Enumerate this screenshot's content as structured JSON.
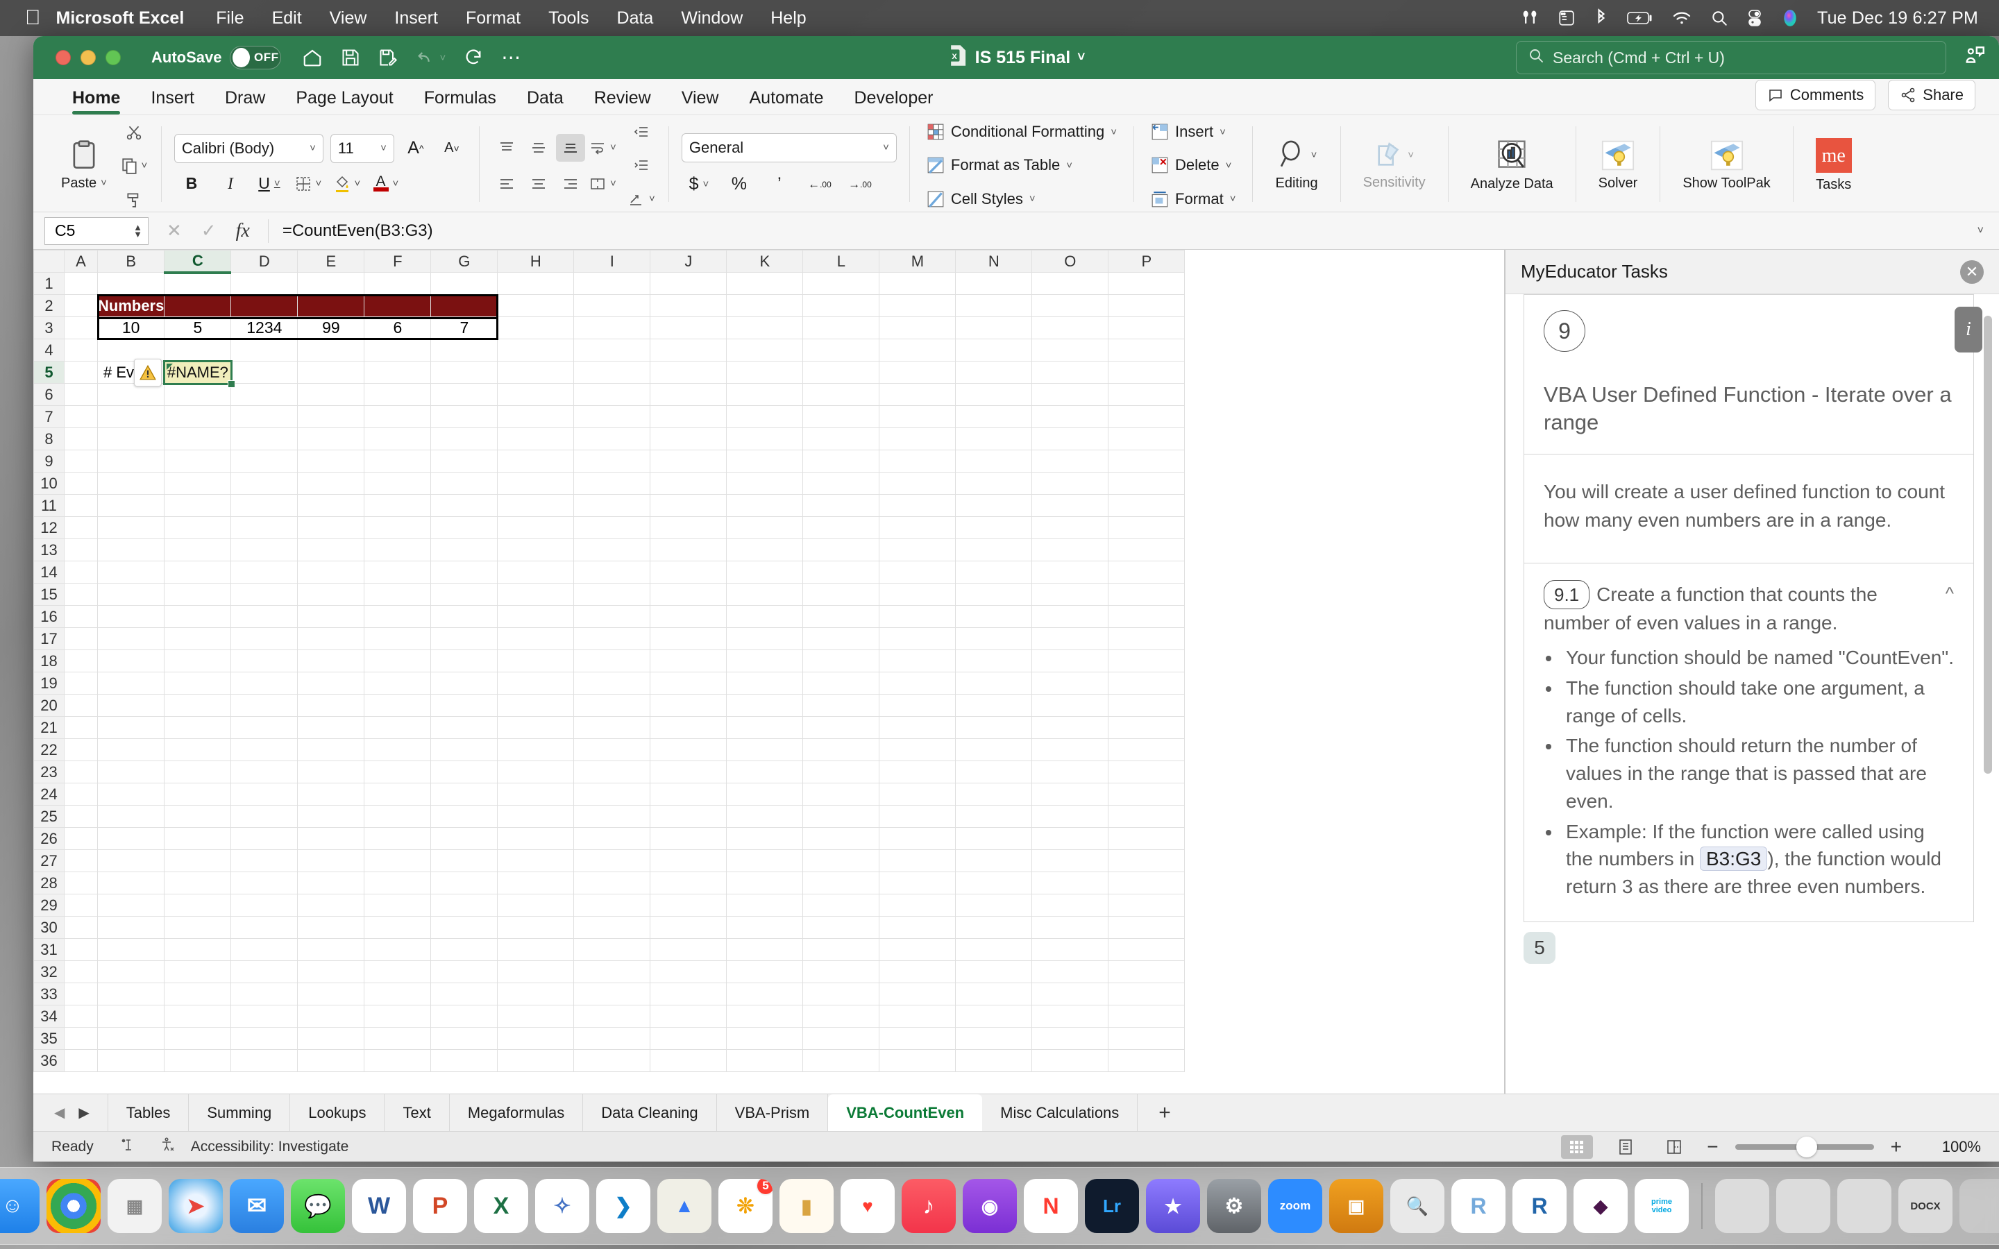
{
  "menubar": {
    "apple": "apple-logo",
    "app": "Microsoft Excel",
    "items": [
      "File",
      "Edit",
      "View",
      "Insert",
      "Format",
      "Tools",
      "Data",
      "Window",
      "Help"
    ],
    "clock": "Tue Dec 19  6:27 PM",
    "status_icons": [
      "airpods-icon",
      "shortcuts-icon",
      "bluetooth-icon",
      "battery-charging-icon",
      "wifi-icon",
      "spotlight-search-icon",
      "control-center-icon",
      "siri-icon"
    ]
  },
  "titlebar": {
    "autosave_label": "AutoSave",
    "autosave_state": "OFF",
    "document_title": "IS 515 Final",
    "quick_access": [
      "home-icon",
      "save-icon",
      "save-as-icon",
      "undo-icon",
      "redo-icon",
      "more-icon"
    ],
    "search_placeholder": "Search (Cmd + Ctrl + U)",
    "collab_icon": "collaborate-icon",
    "accent_color": "#2f7d4f"
  },
  "ribbon": {
    "tabs": [
      "Home",
      "Insert",
      "Draw",
      "Page Layout",
      "Formulas",
      "Data",
      "Review",
      "View",
      "Automate",
      "Developer"
    ],
    "active_tab": "Home",
    "comments_label": "Comments",
    "share_label": "Share",
    "clipboard": {
      "paste_label": "Paste",
      "cut_icon": "scissors-icon",
      "copy_icon": "copy-icon",
      "format_painter_icon": "paintbrush-icon"
    },
    "font": {
      "family": "Calibri (Body)",
      "size": "11",
      "grow_icon": "increase-font-size-icon",
      "shrink_icon": "decrease-font-size-icon",
      "bold": "B",
      "italic": "I",
      "underline": "U",
      "borders_icon": "borders-icon",
      "fill_icon": "fill-color-icon",
      "font_color_icon": "font-color-icon"
    },
    "alignment": {
      "align_top_icon": "align-top-icon",
      "align_middle_icon": "align-middle-icon",
      "align_bottom_icon": "align-bottom-icon",
      "wrap_text_icon": "wrap-text-icon",
      "align_left_icon": "align-left-icon",
      "align_center_icon": "align-center-icon",
      "align_right_icon": "align-right-icon",
      "merge_icon": "merge-cells-icon",
      "decrease_indent_icon": "decrease-indent-icon",
      "increase_indent_icon": "increase-indent-icon",
      "orientation_icon": "text-orientation-icon"
    },
    "number": {
      "format": "General",
      "currency_icon": "currency-icon",
      "percent_icon": "percent-icon",
      "comma_icon": "comma-style-icon",
      "increase_decimal_icon": "increase-decimal-icon",
      "decrease_decimal_icon": "decrease-decimal-icon"
    },
    "styles": [
      {
        "label": "Conditional Formatting",
        "icon": "conditional-formatting-icon"
      },
      {
        "label": "Format as Table",
        "icon": "format-as-table-icon"
      },
      {
        "label": "Cell Styles",
        "icon": "cell-styles-icon"
      }
    ],
    "cells": [
      {
        "label": "Insert",
        "icon": "insert-cells-icon"
      },
      {
        "label": "Delete",
        "icon": "delete-cells-icon"
      },
      {
        "label": "Format",
        "icon": "format-cells-icon"
      }
    ],
    "editing_label": "Editing",
    "right_buttons": [
      {
        "label": "Sensitivity",
        "icon": "sensitivity-icon",
        "dim": true
      },
      {
        "label": "Analyze Data",
        "icon": "analyze-data-icon",
        "dim": false
      },
      {
        "label": "Solver",
        "icon": "solver-icon",
        "dim": false
      },
      {
        "label": "Show ToolPak",
        "icon": "show-toolpak-icon",
        "dim": false
      },
      {
        "label": "Tasks",
        "icon": "me-tasks-icon",
        "dim": false
      }
    ]
  },
  "formula_bar": {
    "name_box": "C5",
    "cancel_icon": "cancel-icon",
    "enter_icon": "confirm-icon",
    "fx_icon": "insert-function-icon",
    "formula": "=CountEven(B3:G3)",
    "expand_icon": "expand-formula-bar-icon"
  },
  "grid": {
    "columns": [
      "A",
      "B",
      "C",
      "D",
      "E",
      "F",
      "G",
      "H",
      "I",
      "J",
      "K",
      "L",
      "M",
      "N",
      "O",
      "P"
    ],
    "selected_column": "C",
    "rows": [
      1,
      2,
      3,
      4,
      5,
      6,
      7,
      8,
      9,
      10,
      11,
      12,
      13,
      14,
      15,
      16,
      17,
      18,
      19,
      20,
      21,
      22,
      23,
      24,
      25,
      26,
      27,
      28,
      29,
      30,
      31,
      32,
      33,
      34,
      35,
      36
    ],
    "selected_row": 5,
    "table_header": {
      "cell": "B2",
      "text": "Numbers",
      "bg": "#7b1111",
      "fg": "#ffffff"
    },
    "numbers_row": {
      "row": 3,
      "cells": [
        "10",
        "5",
        "1234",
        "99",
        "6",
        "7"
      ]
    },
    "label_cell": {
      "cell": "B5",
      "text": "# Even"
    },
    "active_cell": {
      "cell": "C5",
      "display": "#NAME?",
      "bg": "#f1eebc"
    },
    "warning_icon": "warning-triangle-icon"
  },
  "task_pane": {
    "title": "MyEducator Tasks",
    "close_icon": "close-icon",
    "info_icon": "info-icon",
    "task_number": "9",
    "task_title": "VBA User Defined Function - Iterate over a range",
    "task_description": "You will create a user defined function to count how many even numbers are in a range.",
    "subtask": {
      "number": "9.1",
      "heading": "Create a function that counts the number of even values in a range.",
      "collapse_icon": "chevron-up-icon",
      "bullets": [
        "Your function should be named \"CountEven\".",
        "The function should take one argument, a range of cells.",
        "The function should return the number of values in the range that is passed that are even.",
        "Example: If the function were called using the numbers in B3:G3), the function would return 3 as there are three even numbers."
      ],
      "bullet4_prefix": "Example: If the function were called using the numbers in ",
      "bullet4_code": "B3:G3",
      "bullet4_suffix": "), the function would return 3 as there are three even numbers."
    },
    "next_task_number": "5"
  },
  "sheet_tabs": {
    "prev_icon": "previous-sheet-icon",
    "next_icon": "next-sheet-icon",
    "tabs": [
      "Tables",
      "Summing",
      "Lookups",
      "Text",
      "Megaformulas",
      "Data Cleaning",
      "VBA-Prism",
      "VBA-CountEven",
      "Misc Calculations"
    ],
    "active": "VBA-CountEven",
    "add_label": "+"
  },
  "status_bar": {
    "state": "Ready",
    "state_icon": "cell-mode-icon",
    "accessibility_icon": "accessibility-icon",
    "accessibility_label": "Accessibility: Investigate",
    "views": [
      "normal-view-icon",
      "page-layout-view-icon",
      "page-break-view-icon"
    ],
    "active_view": "normal-view-icon",
    "zoom_out_label": "−",
    "zoom_in_label": "+",
    "zoom_level": "100%"
  },
  "dock": {
    "icons": [
      {
        "name": "finder-icon",
        "glyph": "",
        "bg": "linear-gradient(180deg,#4aa8ff,#1e80e8)",
        "running": true
      },
      {
        "name": "google-chrome-icon",
        "glyph": "",
        "bg": "radial-gradient(circle at 50% 50%, #fff 0 16%, #4285f4 16% 34%, #34a853 34% 60%, #fbbc05 60% 78%, #ea4335 78% 100%)",
        "running": true
      },
      {
        "name": "launchpad-icon",
        "glyph": "",
        "bg": "#f2f2f2",
        "running": false
      },
      {
        "name": "safari-icon",
        "glyph": "",
        "bg": "radial-gradient(circle,#eaf4ff 30%,#2f9be3 100%)",
        "running": false
      },
      {
        "name": "mail-icon",
        "glyph": "✉",
        "bg": "linear-gradient(180deg,#4aa8ff,#2a7fe0)",
        "running": false
      },
      {
        "name": "messages-icon",
        "glyph": "",
        "bg": "linear-gradient(180deg,#6ce36c,#35c23a)",
        "running": false
      },
      {
        "name": "microsoft-word-icon",
        "glyph": "W",
        "bg": "#ffffff",
        "running": false
      },
      {
        "name": "microsoft-powerpoint-icon",
        "glyph": "P",
        "bg": "#ffffff",
        "running": false
      },
      {
        "name": "microsoft-excel-icon",
        "glyph": "X",
        "bg": "#ffffff",
        "running": true
      },
      {
        "name": "sparkles-app-icon",
        "glyph": "",
        "bg": "#ffffff",
        "running": false
      },
      {
        "name": "visual-studio-code-icon",
        "glyph": "",
        "bg": "#ffffff",
        "running": false
      },
      {
        "name": "maps-icon",
        "glyph": "",
        "bg": "#f0efe6",
        "running": false
      },
      {
        "name": "photos-icon",
        "glyph": "",
        "bg": "#ffffff",
        "running": false,
        "badge": "5"
      },
      {
        "name": "notes-icon",
        "glyph": "",
        "bg": "#fffaf0",
        "running": false
      },
      {
        "name": "health-icon",
        "glyph": "",
        "bg": "#ffffff",
        "running": false
      },
      {
        "name": "music-icon",
        "glyph": "♪",
        "bg": "linear-gradient(180deg,#fc5c65,#f3344a)",
        "running": false
      },
      {
        "name": "podcasts-icon",
        "glyph": "",
        "bg": "linear-gradient(180deg,#a457e8,#7b2fd4)",
        "running": false
      },
      {
        "name": "news-icon",
        "glyph": "N",
        "bg": "#ffffff",
        "running": false
      },
      {
        "name": "lightroom-icon",
        "glyph": "Lr",
        "bg": "#0f1b2d",
        "running": false
      },
      {
        "name": "awards-app-icon",
        "glyph": "★",
        "bg": "linear-gradient(180deg,#8e7bff,#5b4bd6)",
        "running": false
      },
      {
        "name": "settings-icon",
        "glyph": "",
        "bg": "linear-gradient(180deg,#9aa0a6,#5f6368)",
        "running": false
      },
      {
        "name": "zoom-icon",
        "glyph": "zoom",
        "bg": "#2d8cff",
        "running": false
      },
      {
        "name": "keynote-icon",
        "glyph": "",
        "bg": "linear-gradient(180deg,#f0a020,#d07a10)",
        "running": false
      },
      {
        "name": "preview-icon",
        "glyph": "",
        "bg": "#e9e9e9",
        "running": false
      },
      {
        "name": "r-studio-icon",
        "glyph": "R",
        "bg": "#ffffff",
        "running": false
      },
      {
        "name": "r-icon",
        "glyph": "R",
        "bg": "#ffffff",
        "running": false
      },
      {
        "name": "slack-icon",
        "glyph": "",
        "bg": "#ffffff",
        "running": false
      },
      {
        "name": "amazon-prime-video-icon",
        "glyph": "prime video",
        "bg": "#ffffff",
        "running": false
      }
    ],
    "right_icons": [
      {
        "name": "screenshot-folder-icon",
        "glyph": ""
      },
      {
        "name": "finder-search-icon",
        "glyph": ""
      },
      {
        "name": "quicktime-icon",
        "glyph": ""
      },
      {
        "name": "docx-file-icon",
        "glyph": "DOCX"
      },
      {
        "name": "trash-icon",
        "glyph": ""
      }
    ]
  }
}
